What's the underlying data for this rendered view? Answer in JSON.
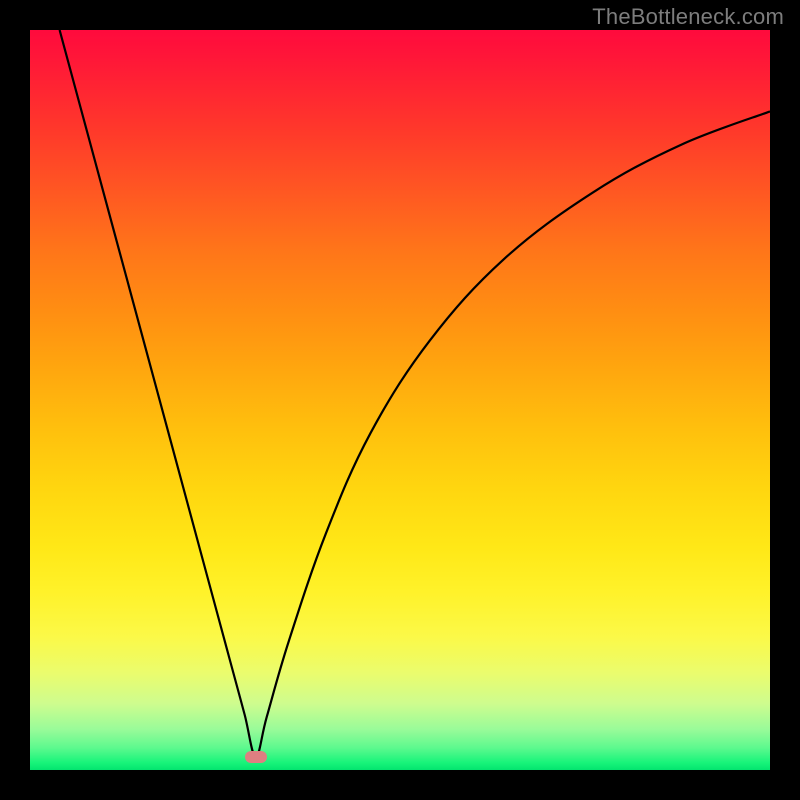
{
  "watermark": "TheBottleneck.com",
  "chart_data": {
    "type": "line",
    "title": "",
    "xlabel": "",
    "ylabel": "",
    "xlim": [
      0,
      1
    ],
    "ylim": [
      0,
      1
    ],
    "grid": false,
    "legend": false,
    "background_gradient": {
      "top": "#ff0a3d",
      "bottom": "#03e46f",
      "description": "vertical red-to-green gradient representing severity"
    },
    "minimum_point": {
      "x": 0.305,
      "y": 0.018
    },
    "marker": {
      "x": 0.305,
      "y": 0.018,
      "color": "#de7f81",
      "shape": "rounded-rect"
    },
    "series": [
      {
        "name": "bottleneck-curve",
        "color": "#000000",
        "stroke_width": 2,
        "x": [
          0.04,
          0.08,
          0.12,
          0.16,
          0.2,
          0.24,
          0.27,
          0.29,
          0.305,
          0.32,
          0.35,
          0.4,
          0.46,
          0.54,
          0.64,
          0.76,
          0.88,
          1.0
        ],
        "y": [
          1.0,
          0.852,
          0.704,
          0.556,
          0.408,
          0.26,
          0.149,
          0.075,
          0.018,
          0.072,
          0.175,
          0.32,
          0.455,
          0.58,
          0.69,
          0.78,
          0.845,
          0.89
        ]
      }
    ]
  }
}
